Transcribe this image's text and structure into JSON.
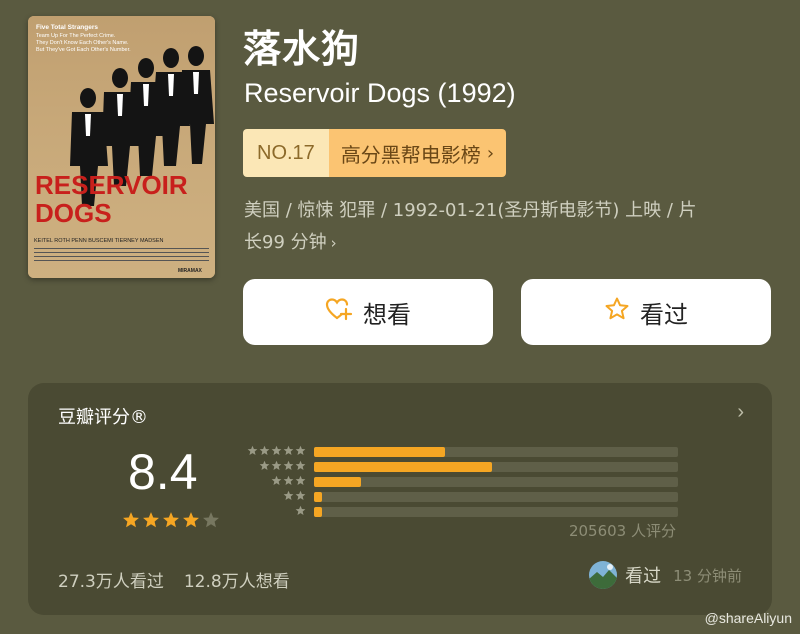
{
  "movie": {
    "title_cn": "落水狗",
    "title_en": "Reservoir Dogs (1992)",
    "meta_line1": "美国 / 惊悚 犯罪 / 1992-01-21(圣丹斯电影节) 上映 / 片",
    "meta_line2": "长99 分钟",
    "poster": {
      "tagline1": "Five Total Strangers",
      "tagline2": "Team Up For The Perfect Crime.",
      "tagline3": "They Don't Know Each Other's Name.",
      "tagline4": "But They've Got Each Other's Number.",
      "title_line1": "RESERVOIR",
      "title_line2": "DOGS",
      "cast": "KEITEL  ROTH  PENN  BUSCEMI  TIERNEY  MADSEN",
      "studio": "MIRAMAX"
    }
  },
  "rank": {
    "number": "NO.17",
    "list_name": "高分黑帮电影榜"
  },
  "actions": {
    "want_label": "想看",
    "seen_label": "看过"
  },
  "rating": {
    "title": "豆瓣评分®",
    "score": "8.4",
    "score_value": 8.4,
    "count_text": "205603 人评分",
    "distribution": [
      {
        "stars": 5,
        "fraction": 0.36
      },
      {
        "stars": 4,
        "fraction": 0.49
      },
      {
        "stars": 3,
        "fraction": 0.13
      },
      {
        "stars": 2,
        "fraction": 0.02
      },
      {
        "stars": 1,
        "fraction": 0.02
      }
    ],
    "watched_text": "27.3万人看过",
    "wish_text": "12.8万人想看"
  },
  "friend": {
    "action": "看过",
    "time": "13 分钟前"
  },
  "watermark": "@shareAliyun",
  "colors": {
    "background": "#5a5a40",
    "card": "#4a4a33",
    "accent": "#f5a623",
    "rank_light": "#fbe7b6",
    "rank_dark": "#fbc472"
  },
  "icons": {
    "want": "heart-plus-icon",
    "seen": "star-outline-icon",
    "chevron": "chevron-right-icon"
  }
}
